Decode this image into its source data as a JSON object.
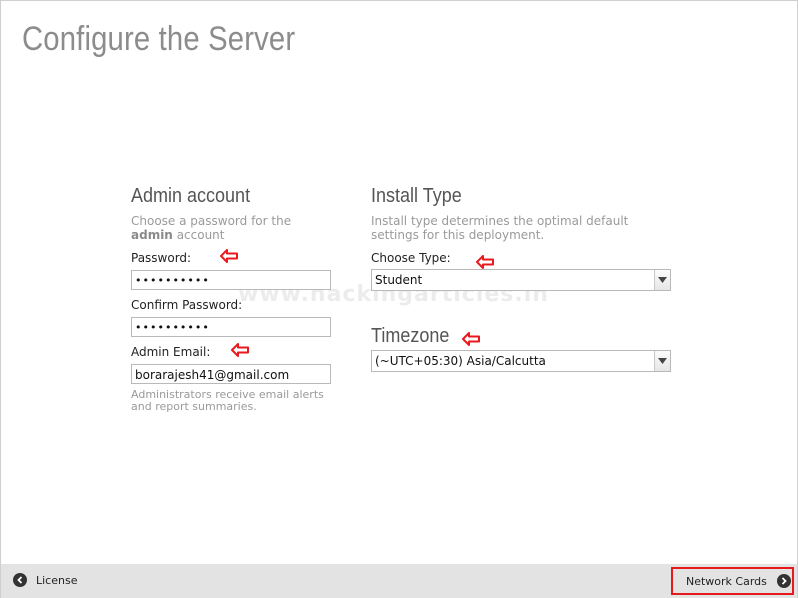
{
  "page": {
    "title": "Configure the Server"
  },
  "admin": {
    "heading": "Admin account",
    "desc_part1": "Choose a password for the",
    "desc_bold": "admin",
    "desc_part2": "account",
    "password_label": "Password:",
    "password_value": "••••••••••",
    "confirm_label": "Confirm Password:",
    "confirm_value": "••••••••••",
    "email_label": "Admin Email:",
    "email_value": "borarajesh41@gmail.com",
    "email_note": "Administrators receive email alerts and report summaries."
  },
  "install": {
    "heading": "Install Type",
    "desc": "Install type determines the optimal default settings for this deployment.",
    "type_label": "Choose Type:",
    "type_value": "Student"
  },
  "timezone": {
    "heading": "Timezone",
    "value": "(~UTC+05:30) Asia/Calcutta"
  },
  "watermark": "www.hackingarticles.in",
  "footer": {
    "back_label": "License",
    "next_label": "Network Cards"
  },
  "colors": {
    "annotation_red": "#e8191e",
    "footer_bg": "#e3e3e3"
  }
}
